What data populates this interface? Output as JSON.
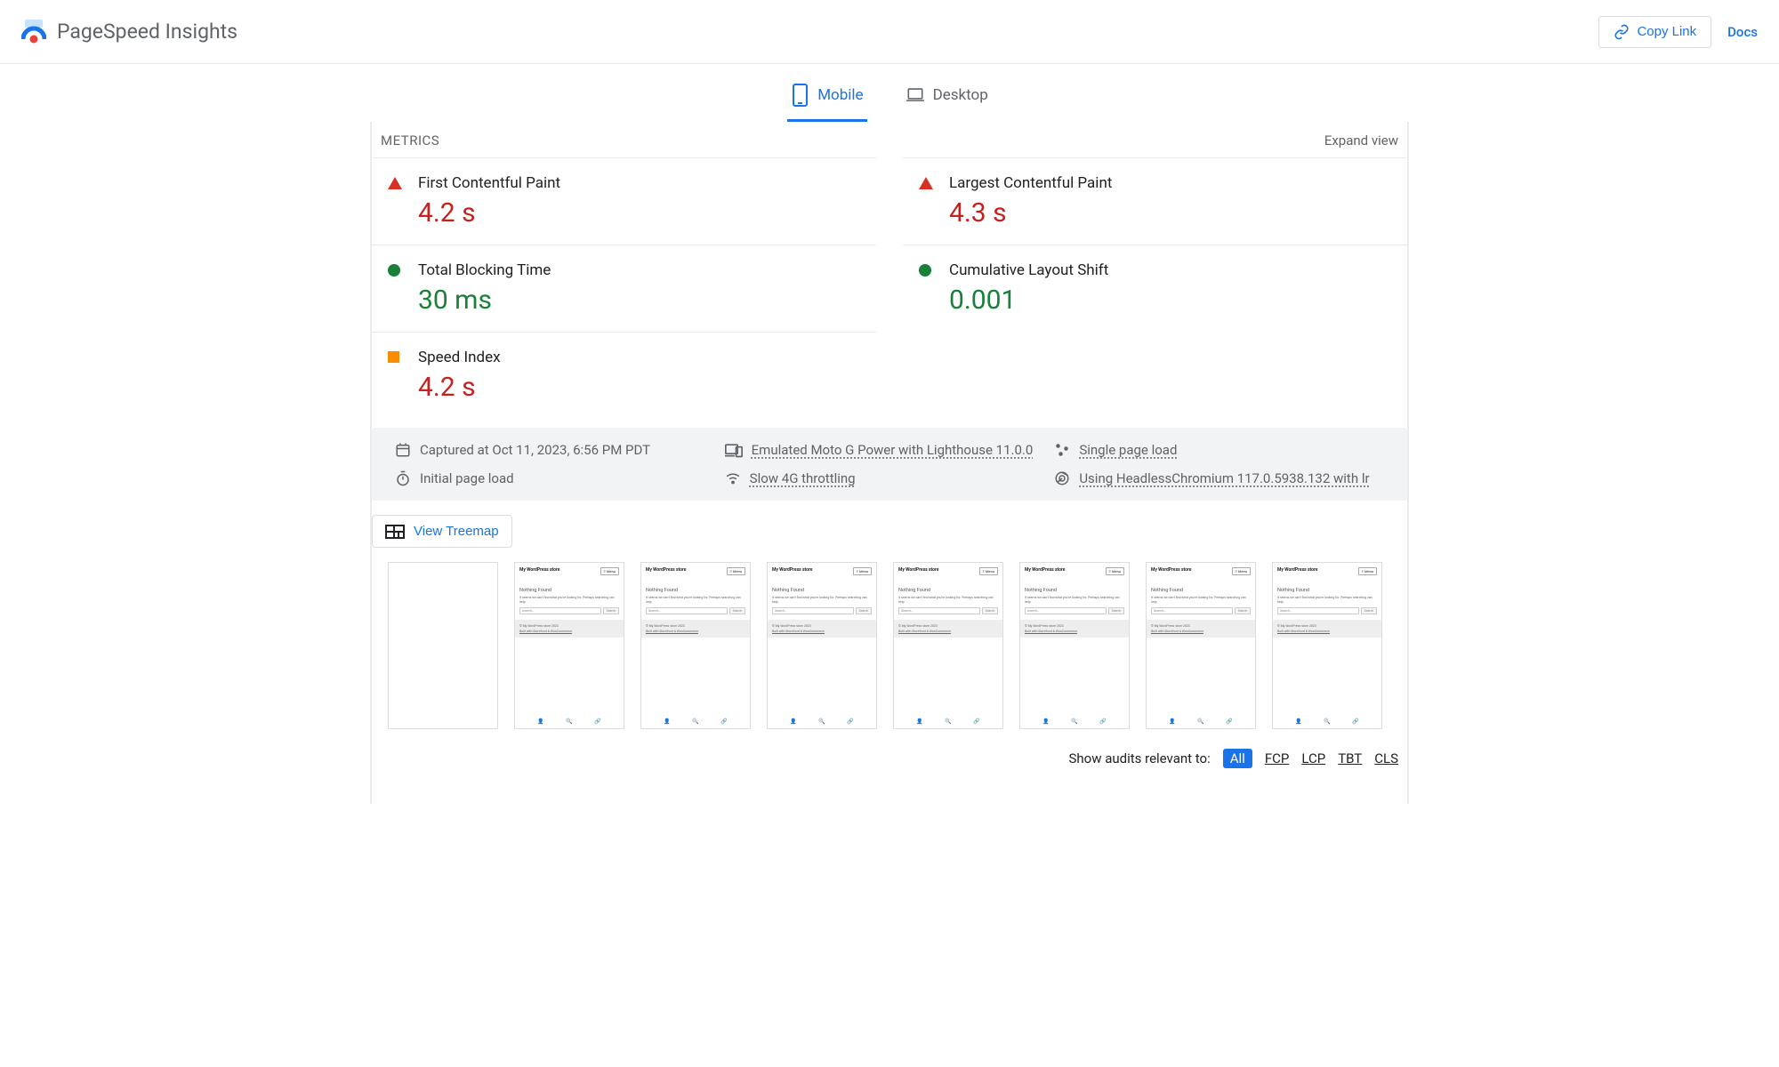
{
  "header": {
    "app_title": "PageSpeed Insights",
    "copy_link_label": "Copy Link",
    "docs_label": "Docs"
  },
  "tabs": {
    "mobile_label": "Mobile",
    "desktop_label": "Desktop"
  },
  "metrics_section": {
    "label": "METRICS",
    "expand_label": "Expand view"
  },
  "metrics": {
    "fcp": {
      "name": "First Contentful Paint",
      "value": "4.2 s",
      "status": "poor"
    },
    "lcp": {
      "name": "Largest Contentful Paint",
      "value": "4.3 s",
      "status": "poor"
    },
    "tbt": {
      "name": "Total Blocking Time",
      "value": "30 ms",
      "status": "good"
    },
    "cls": {
      "name": "Cumulative Layout Shift",
      "value": "0.001",
      "status": "good"
    },
    "si": {
      "name": "Speed Index",
      "value": "4.2 s",
      "status": "average"
    }
  },
  "env": {
    "captured": "Captured at Oct 11, 2023, 6:56 PM PDT",
    "device": "Emulated Moto G Power with Lighthouse 11.0.0",
    "load_type": "Single page load",
    "initial": "Initial page load",
    "throttling": "Slow 4G throttling",
    "browser": "Using HeadlessChromium 117.0.5938.132 with lr"
  },
  "treemap": {
    "label": "View Treemap"
  },
  "filmstrip_frame": {
    "site_title": "My WordPress store",
    "menu": "≡ Menu",
    "heading": "Nothing Found",
    "text": "It seems we can't find what you're looking for. Perhaps searching can help.",
    "search_ph": "Search…",
    "search_btn": "Search",
    "copyright": "© My WordPress store 2023",
    "built": "Built with Storefront & WooCommerce"
  },
  "audits_filter": {
    "label": "Show audits relevant to:",
    "all": "All",
    "fcp": "FCP",
    "lcp": "LCP",
    "tbt": "TBT",
    "cls": "CLS"
  }
}
